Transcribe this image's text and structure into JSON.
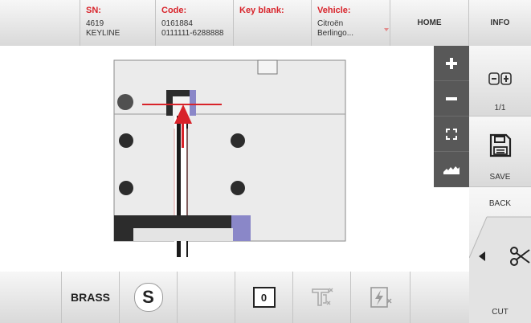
{
  "header": {
    "sn": {
      "label": "SN:",
      "line1": "4619",
      "line2": "KEYLINE"
    },
    "code": {
      "label": "Code:",
      "line1": "0161884",
      "line2": "0111111-6288888"
    },
    "key_blank": {
      "label": "Key blank:"
    },
    "vehicle": {
      "label": "Vehicle:",
      "line1": "Citroën",
      "line2": "Berlingo..."
    },
    "home_label": "HOME",
    "info_label": "INFO"
  },
  "side": {
    "page_indicator": "1/1",
    "save_label": "SAVE",
    "back_label": "BACK",
    "cut_label": "CUT"
  },
  "bottom": {
    "material_label": "BRASS",
    "side_letter": "S",
    "counter_value": "0"
  },
  "colors": {
    "accent_red": "#d8232a",
    "zoom_panel": "#585858",
    "clamp_purple": "#8a87c8"
  },
  "icons": [
    "plus-icon",
    "minus-icon",
    "fit-screen-icon",
    "profile-icon",
    "zoom-toggle-icon",
    "save-icon",
    "left-arrow-icon",
    "scissors-icon",
    "caliper-icon",
    "tracer-icon"
  ]
}
